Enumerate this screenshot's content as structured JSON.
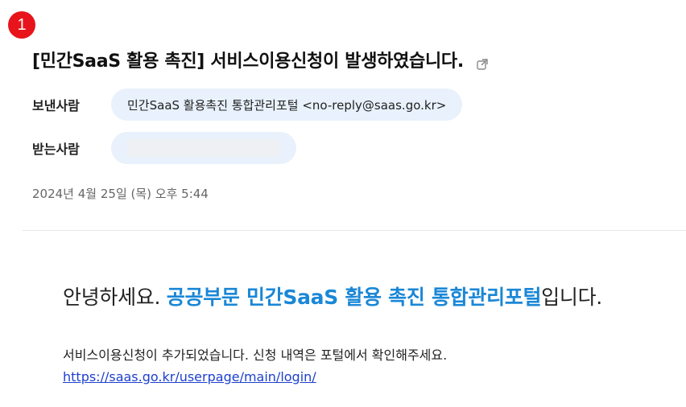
{
  "badge": "1",
  "subject": "[민간SaaS 활용 촉진] 서비스이용신청이 발생하였습니다.",
  "sender": {
    "label": "보낸사람",
    "value": "민간SaaS 활용촉진 통합관리포털 <no-reply@saas.go.kr>"
  },
  "receiver": {
    "label": "받는사람",
    "value": ""
  },
  "date": "2024년 4월 25일 (목) 오후 5:44",
  "body": {
    "greeting_prefix": "안녕하세요. ",
    "greeting_highlight": "공공부문 민간SaaS 활용 촉진 통합관리포털",
    "greeting_suffix": "입니다.",
    "notice": "서비스이용신청이 추가되었습니다. 신청 내역은 포털에서 확인해주세요.",
    "link": "https://saas.go.kr/userpage/main/login/"
  },
  "colors": {
    "badge": "#e8141b",
    "pill": "#e8f1fc",
    "highlight": "#1a87d6",
    "link": "#1d3fcf"
  },
  "icons": {
    "external": "external-link-icon"
  }
}
